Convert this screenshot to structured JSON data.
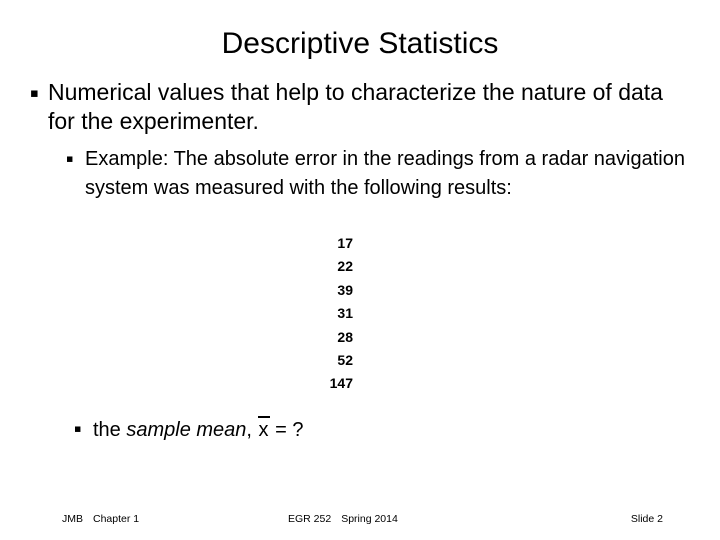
{
  "slide": {
    "title": "Descriptive Statistics",
    "bullet_glyph": "▪",
    "bullets": [
      {
        "level": 1,
        "text": "Numerical values that help to characterize the nature of data for the experimenter."
      },
      {
        "level": 2,
        "text": "Example: The absolute error in the readings from a radar navigation system was measured with the following results:"
      }
    ],
    "data_values": [
      "17",
      "22",
      "39",
      "31",
      "28",
      "52",
      "147"
    ],
    "mean_line": {
      "prefix": "the ",
      "emphasis": "sample mean",
      "separator": ", ",
      "symbol": "x",
      "equals": " = ?"
    },
    "footer": {
      "author": "JMB",
      "chapter": "Chapter 1",
      "course": "EGR 252",
      "term": "Spring 2014",
      "slide_number": "Slide 2"
    }
  }
}
